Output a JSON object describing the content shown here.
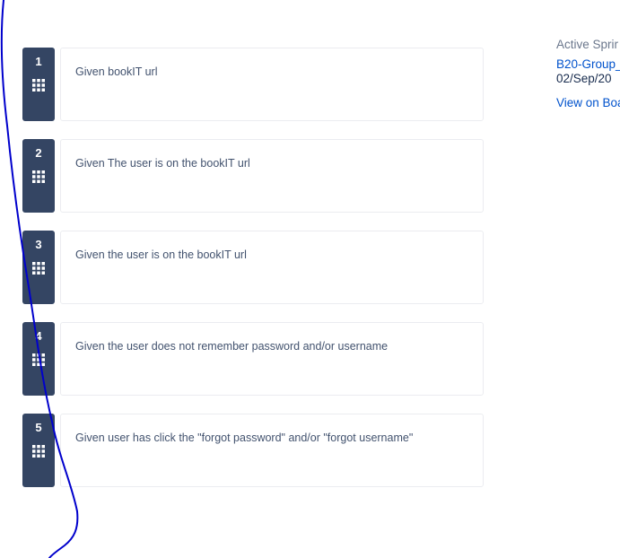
{
  "steps": [
    {
      "number": "1",
      "text": "Given bookIT url"
    },
    {
      "number": "2",
      "text": "Given The user is on the bookIT url"
    },
    {
      "number": "3",
      "text": "Given the user is on the bookIT url"
    },
    {
      "number": "4",
      "text": "Given the user does not remember password and/or username"
    },
    {
      "number": "5",
      "text": "Given user has click the \"forgot password\" and/or \"forgot username\""
    }
  ],
  "sidebar": {
    "active_sprint_label": "Active Sprir",
    "sprint_link": "B20-Group_",
    "sprint_date": "02/Sep/20",
    "view_on_board": "View on Boa"
  },
  "icons": {
    "step_handle": "drag-grid-icon"
  },
  "colors": {
    "step_badge": "#344563",
    "link": "#0052cc",
    "scribble": "#0000cc"
  }
}
